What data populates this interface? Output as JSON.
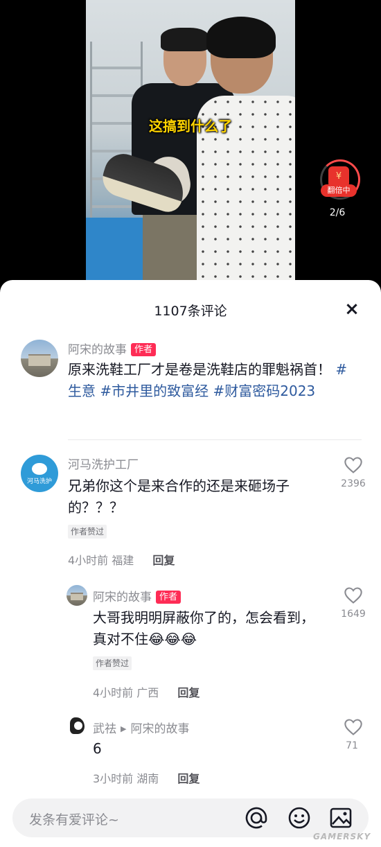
{
  "video": {
    "caption": "这搞到什么了",
    "red_packet": {
      "label": "翻倍中",
      "icon": "¥",
      "progress": "2/6"
    }
  },
  "comments_panel": {
    "title": "1107条评论",
    "close_label": "×",
    "author_post": {
      "author": "阿宋的故事",
      "badge": "作者",
      "text_prefix": "原来洗鞋工厂才是卷是洗鞋店的罪魁祸首！",
      "hashtags": [
        "#生意",
        "#市井里的致富经",
        "#财富密码2023"
      ]
    },
    "comments": [
      {
        "author": "河马洗护工厂",
        "avatar_text": "河马洗护",
        "text": "兄弟你这个是来合作的还是来砸场子的？？？",
        "author_liked": "作者赞过",
        "time": "4小时前",
        "location": "福建",
        "reply_label": "回复",
        "likes": "2396"
      },
      {
        "author": "阿宋的故事",
        "badge": "作者",
        "text": "大哥我明明屏蔽你了的，怎会看到，真对不住😂😂😂",
        "author_liked": "作者赞过",
        "time": "4小时前",
        "location": "广西",
        "reply_label": "回复",
        "likes": "1649"
      },
      {
        "author": "武祛",
        "reply_to": "阿宋的故事",
        "text": "6",
        "time": "3小时前",
        "location": "湖南",
        "reply_label": "回复",
        "likes": "71"
      }
    ],
    "input": {
      "placeholder": "发条有爱评论~"
    }
  },
  "watermark": "GAMERSKY"
}
